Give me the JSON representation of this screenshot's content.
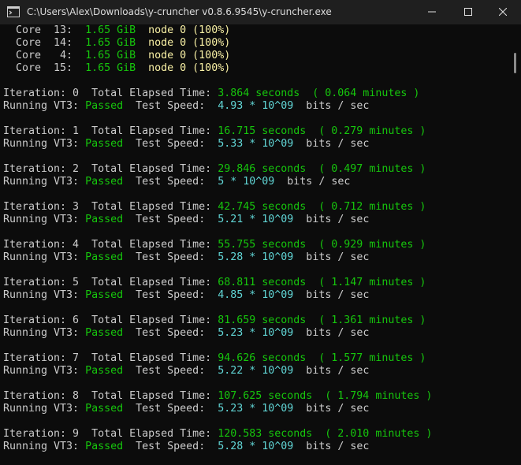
{
  "window": {
    "title": "C:\\Users\\Alex\\Downloads\\y-cruncher v0.8.6.9545\\y-cruncher.exe"
  },
  "colors": {
    "default": "#cccccc",
    "green": "#16c60c",
    "yellow": "#f9f1a5",
    "cyan": "#61d6d6"
  },
  "console": {
    "lines": [
      [
        {
          "t": "  Core  13:  ",
          "c": "default"
        },
        {
          "t": "1.65 GiB",
          "c": "green"
        },
        {
          "t": "  node 0 (100%)",
          "c": "yellow"
        }
      ],
      [
        {
          "t": "  Core  14:  ",
          "c": "default"
        },
        {
          "t": "1.65 GiB",
          "c": "green"
        },
        {
          "t": "  node 0 (100%)",
          "c": "yellow"
        }
      ],
      [
        {
          "t": "  Core   4:  ",
          "c": "default"
        },
        {
          "t": "1.65 GiB",
          "c": "green"
        },
        {
          "t": "  node 0 (100%)",
          "c": "yellow"
        }
      ],
      [
        {
          "t": "  Core  15:  ",
          "c": "default"
        },
        {
          "t": "1.65 GiB",
          "c": "green"
        },
        {
          "t": "  node 0 (100%)",
          "c": "yellow"
        }
      ],
      [],
      [
        {
          "t": "Iteration: 0  Total Elapsed Time: ",
          "c": "default"
        },
        {
          "t": "3.864 seconds  ( 0.064 minutes )",
          "c": "green"
        }
      ],
      [
        {
          "t": "Running VT3: ",
          "c": "default"
        },
        {
          "t": "Passed",
          "c": "green"
        },
        {
          "t": "  Test Speed:  ",
          "c": "default"
        },
        {
          "t": "4.93 * 10^09",
          "c": "cyan"
        },
        {
          "t": "  bits / sec",
          "c": "default"
        }
      ],
      [],
      [
        {
          "t": "Iteration: 1  Total Elapsed Time: ",
          "c": "default"
        },
        {
          "t": "16.715 seconds  ( 0.279 minutes )",
          "c": "green"
        }
      ],
      [
        {
          "t": "Running VT3: ",
          "c": "default"
        },
        {
          "t": "Passed",
          "c": "green"
        },
        {
          "t": "  Test Speed:  ",
          "c": "default"
        },
        {
          "t": "5.33 * 10^09",
          "c": "cyan"
        },
        {
          "t": "  bits / sec",
          "c": "default"
        }
      ],
      [],
      [
        {
          "t": "Iteration: 2  Total Elapsed Time: ",
          "c": "default"
        },
        {
          "t": "29.846 seconds  ( 0.497 minutes )",
          "c": "green"
        }
      ],
      [
        {
          "t": "Running VT3: ",
          "c": "default"
        },
        {
          "t": "Passed",
          "c": "green"
        },
        {
          "t": "  Test Speed:  ",
          "c": "default"
        },
        {
          "t": "5 * 10^09",
          "c": "cyan"
        },
        {
          "t": "  bits / sec",
          "c": "default"
        }
      ],
      [],
      [
        {
          "t": "Iteration: 3  Total Elapsed Time: ",
          "c": "default"
        },
        {
          "t": "42.745 seconds  ( 0.712 minutes )",
          "c": "green"
        }
      ],
      [
        {
          "t": "Running VT3: ",
          "c": "default"
        },
        {
          "t": "Passed",
          "c": "green"
        },
        {
          "t": "  Test Speed:  ",
          "c": "default"
        },
        {
          "t": "5.21 * 10^09",
          "c": "cyan"
        },
        {
          "t": "  bits / sec",
          "c": "default"
        }
      ],
      [],
      [
        {
          "t": "Iteration: 4  Total Elapsed Time: ",
          "c": "default"
        },
        {
          "t": "55.755 seconds  ( 0.929 minutes )",
          "c": "green"
        }
      ],
      [
        {
          "t": "Running VT3: ",
          "c": "default"
        },
        {
          "t": "Passed",
          "c": "green"
        },
        {
          "t": "  Test Speed:  ",
          "c": "default"
        },
        {
          "t": "5.28 * 10^09",
          "c": "cyan"
        },
        {
          "t": "  bits / sec",
          "c": "default"
        }
      ],
      [],
      [
        {
          "t": "Iteration: 5  Total Elapsed Time: ",
          "c": "default"
        },
        {
          "t": "68.811 seconds  ( 1.147 minutes )",
          "c": "green"
        }
      ],
      [
        {
          "t": "Running VT3: ",
          "c": "default"
        },
        {
          "t": "Passed",
          "c": "green"
        },
        {
          "t": "  Test Speed:  ",
          "c": "default"
        },
        {
          "t": "4.85 * 10^09",
          "c": "cyan"
        },
        {
          "t": "  bits / sec",
          "c": "default"
        }
      ],
      [],
      [
        {
          "t": "Iteration: 6  Total Elapsed Time: ",
          "c": "default"
        },
        {
          "t": "81.659 seconds  ( 1.361 minutes )",
          "c": "green"
        }
      ],
      [
        {
          "t": "Running VT3: ",
          "c": "default"
        },
        {
          "t": "Passed",
          "c": "green"
        },
        {
          "t": "  Test Speed:  ",
          "c": "default"
        },
        {
          "t": "5.23 * 10^09",
          "c": "cyan"
        },
        {
          "t": "  bits / sec",
          "c": "default"
        }
      ],
      [],
      [
        {
          "t": "Iteration: 7  Total Elapsed Time: ",
          "c": "default"
        },
        {
          "t": "94.626 seconds  ( 1.577 minutes )",
          "c": "green"
        }
      ],
      [
        {
          "t": "Running VT3: ",
          "c": "default"
        },
        {
          "t": "Passed",
          "c": "green"
        },
        {
          "t": "  Test Speed:  ",
          "c": "default"
        },
        {
          "t": "5.22 * 10^09",
          "c": "cyan"
        },
        {
          "t": "  bits / sec",
          "c": "default"
        }
      ],
      [],
      [
        {
          "t": "Iteration: 8  Total Elapsed Time: ",
          "c": "default"
        },
        {
          "t": "107.625 seconds  ( 1.794 minutes )",
          "c": "green"
        }
      ],
      [
        {
          "t": "Running VT3: ",
          "c": "default"
        },
        {
          "t": "Passed",
          "c": "green"
        },
        {
          "t": "  Test Speed:  ",
          "c": "default"
        },
        {
          "t": "5.23 * 10^09",
          "c": "cyan"
        },
        {
          "t": "  bits / sec",
          "c": "default"
        }
      ],
      [],
      [
        {
          "t": "Iteration: 9  Total Elapsed Time: ",
          "c": "default"
        },
        {
          "t": "120.583 seconds  ( 2.010 minutes )",
          "c": "green"
        }
      ],
      [
        {
          "t": "Running VT3: ",
          "c": "default"
        },
        {
          "t": "Passed",
          "c": "green"
        },
        {
          "t": "  Test Speed:  ",
          "c": "default"
        },
        {
          "t": "5.28 * 10^09",
          "c": "cyan"
        },
        {
          "t": "  bits / sec",
          "c": "default"
        }
      ]
    ]
  },
  "icons": {
    "app": "console-app-icon",
    "minimize": "minimize-icon",
    "maximize": "maximize-icon",
    "close": "close-icon"
  }
}
